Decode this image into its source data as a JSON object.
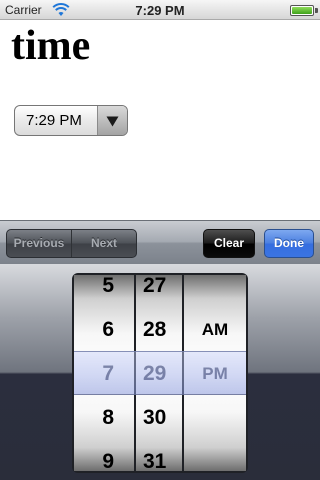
{
  "status_bar": {
    "carrier": "Carrier",
    "time": "7:29 PM",
    "wifi_icon": "wifi-icon",
    "battery_icon": "battery-icon"
  },
  "page": {
    "title": "time"
  },
  "time_select": {
    "value": "7:29 PM",
    "arrow_icon": "triangle-down-icon"
  },
  "toolbar": {
    "previous_label": "Previous",
    "next_label": "Next",
    "clear_label": "Clear",
    "done_label": "Done"
  },
  "picker": {
    "hours": [
      "5",
      "6",
      "7",
      "8",
      "9"
    ],
    "minutes": [
      "27",
      "28",
      "29",
      "30",
      "31"
    ],
    "ampm": [
      "",
      "AM",
      "PM",
      "",
      ""
    ],
    "selected": {
      "hour": "7",
      "minute": "29",
      "ampm": "PM"
    }
  },
  "colors": {
    "done_button": "#3b74e2",
    "clear_button": "#000000",
    "selection_band": "#8c9bdc"
  }
}
